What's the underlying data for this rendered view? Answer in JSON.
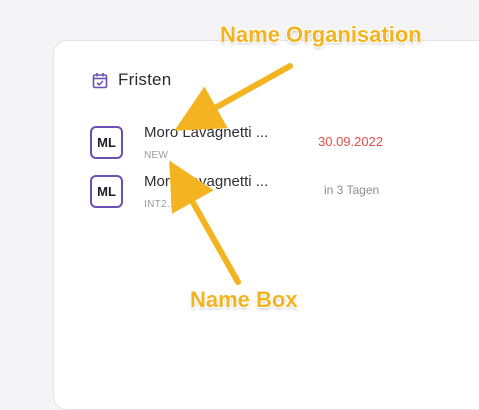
{
  "panel": {
    "title": "Fristen",
    "items": [
      {
        "avatar": "ML",
        "name": "Moro Lavagnetti ...",
        "sub": "NEW",
        "date": "30.09.2022"
      },
      {
        "avatar": "ML",
        "name": "Moro Lavagnetti ...",
        "sub": "INT2.1",
        "date": "in 3 Tagen"
      }
    ]
  },
  "annotations": {
    "top": "Name Organisation",
    "bottom": "Name Box"
  },
  "colors": {
    "accent": "#6b4fb3",
    "overdue_date": "#e0504a",
    "annotation": "#f4b320"
  }
}
